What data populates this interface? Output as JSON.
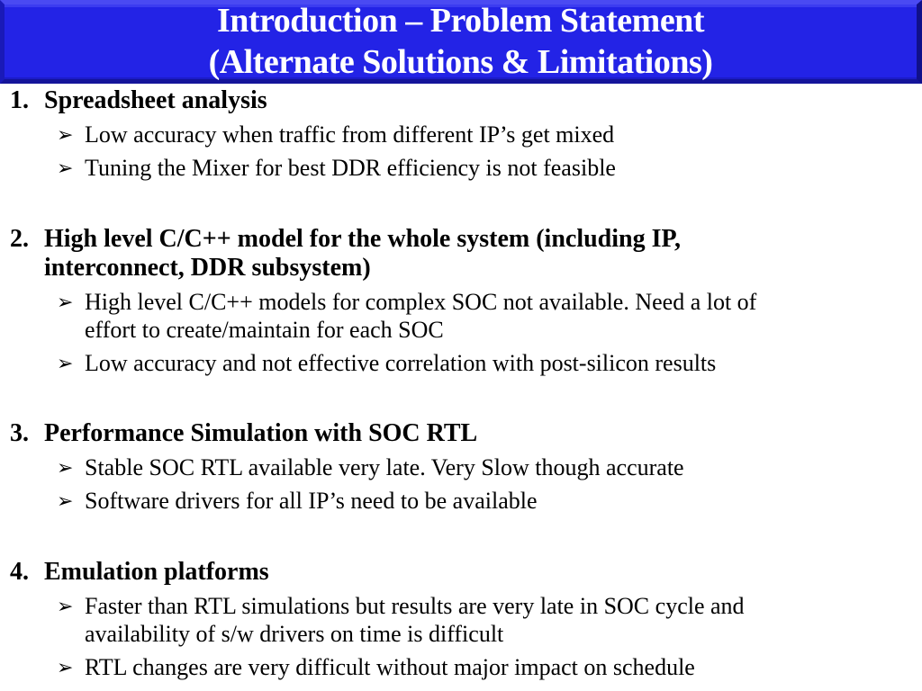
{
  "slide": {
    "title_line1": "Introduction – Problem Statement",
    "title_line2": "(Alternate Solutions & Limitations)",
    "bullet_icon": "arrowhead-bullet",
    "colors": {
      "banner": "#2323e6",
      "banner_text": "#ffffff",
      "body_text": "#000000"
    },
    "items": [
      {
        "number": "1.",
        "heading_lines": [
          "Spreadsheet analysis"
        ],
        "subs": [
          [
            "Low accuracy when traffic from different IP’s get mixed"
          ],
          [
            "Tuning the Mixer for best DDR efficiency is not feasible"
          ]
        ]
      },
      {
        "number": "2.",
        "heading_lines": [
          "High level C/C++ model for the whole system (including IP,",
          "interconnect, DDR subsystem)"
        ],
        "subs": [
          [
            "High level C/C++ models for complex SOC not available. Need a lot of",
            "effort to create/maintain for each SOC"
          ],
          [
            "Low accuracy  and not effective correlation with post-silicon results"
          ]
        ]
      },
      {
        "number": "3.",
        "heading_lines": [
          "Performance Simulation with SOC RTL"
        ],
        "subs": [
          [
            "Stable SOC RTL available very late. Very Slow though accurate"
          ],
          [
            "Software drivers for all IP’s need to be available"
          ]
        ]
      },
      {
        "number": "4.",
        "heading_lines": [
          "Emulation platforms"
        ],
        "subs": [
          [
            "Faster than RTL simulations but results are very late in SOC cycle and",
            "availability of s/w drivers on time is difficult"
          ],
          [
            "RTL changes are very difficult without major impact on schedule"
          ]
        ]
      }
    ]
  }
}
